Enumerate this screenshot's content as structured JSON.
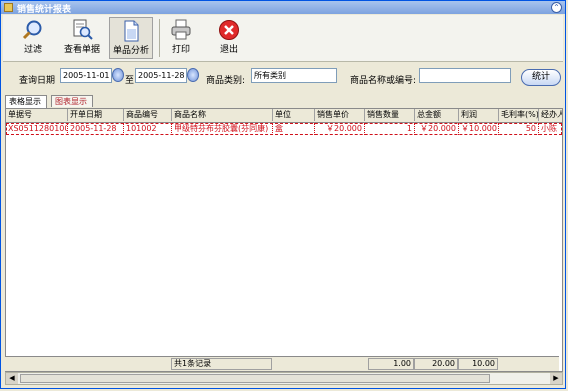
{
  "window": {
    "title": "销售统计报表"
  },
  "toolbar": [
    {
      "label": "过滤",
      "icon": "magnifier-icon"
    },
    {
      "label": "查看单据",
      "icon": "view-document-icon"
    },
    {
      "label": "单品分析",
      "icon": "document-icon"
    },
    {
      "label": "打印",
      "icon": "printer-icon"
    },
    {
      "label": "退出",
      "icon": "exit-icon"
    }
  ],
  "filter": {
    "query_date_label": "查询日期",
    "date_from": "2005-11-01",
    "to_label": "至",
    "date_to": "2005-11-28",
    "category_label": "商品类别:",
    "category_value": "所有类别",
    "name_code_label": "商品名称或编号:",
    "name_code_value": "",
    "stat_button": "统计"
  },
  "tabs": [
    "表格显示",
    "图表显示"
  ],
  "table": {
    "headers": [
      "单据号",
      "开单日期",
      "商品编号",
      "商品名称",
      "单位",
      "销售单价",
      "销售数量",
      "总金额",
      "利润",
      "毛利率(%)",
      "经办人"
    ],
    "rows": [
      [
        "XS051128010001",
        "2005-11-28",
        "101002",
        "甲级特芬布芬胶囊(芬同康)",
        "盒",
        "￥20.000",
        "1",
        "￥20.000",
        "￥10.000",
        "50",
        "小陈"
      ]
    ],
    "footer": {
      "count": "共1条记录",
      "qty_total": "1.00",
      "amount_total": "20.00",
      "profit_total": "10.00"
    }
  },
  "colors": {
    "accent_red": "#d0101a",
    "title_blue": "#7da2df"
  }
}
